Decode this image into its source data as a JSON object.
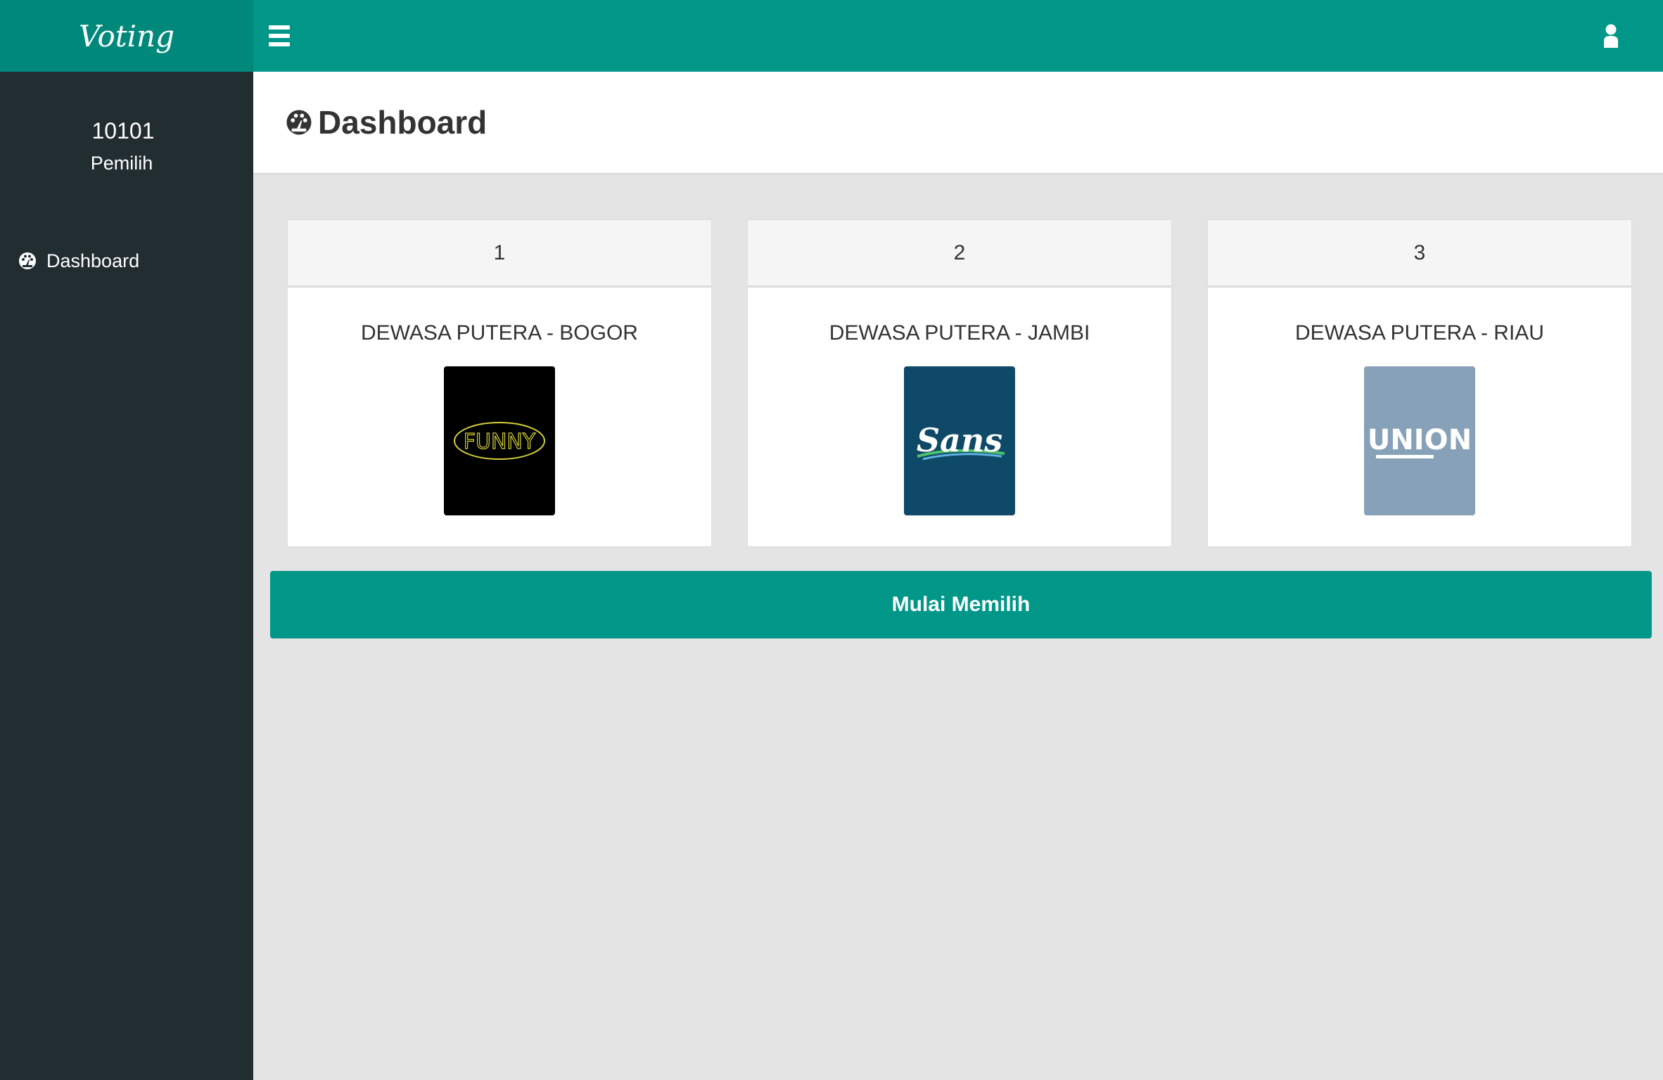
{
  "app": {
    "brand": "Voting"
  },
  "user": {
    "id": "10101",
    "role": "Pemilih"
  },
  "sidebar": {
    "items": [
      {
        "label": "Dashboard",
        "icon": "dashboard-icon"
      }
    ]
  },
  "header": {
    "menu_icon": "hamburger-icon",
    "user_icon": "user-icon"
  },
  "page": {
    "title": "Dashboard"
  },
  "candidates": [
    {
      "number": "1",
      "name": "DEWASA PUTERA - BOGOR",
      "logo_text": "FUNNY"
    },
    {
      "number": "2",
      "name": "DEWASA PUTERA - JAMBI",
      "logo_text": "Sans"
    },
    {
      "number": "3",
      "name": "DEWASA PUTERA - RIAU",
      "logo_text": "UNION"
    }
  ],
  "actions": {
    "start_label": "Mulai Memilih"
  },
  "colors": {
    "primary": "#009688",
    "brand_bg": "#00897b",
    "sidebar_bg": "#222d32",
    "content_bg": "#e4e4e4"
  }
}
